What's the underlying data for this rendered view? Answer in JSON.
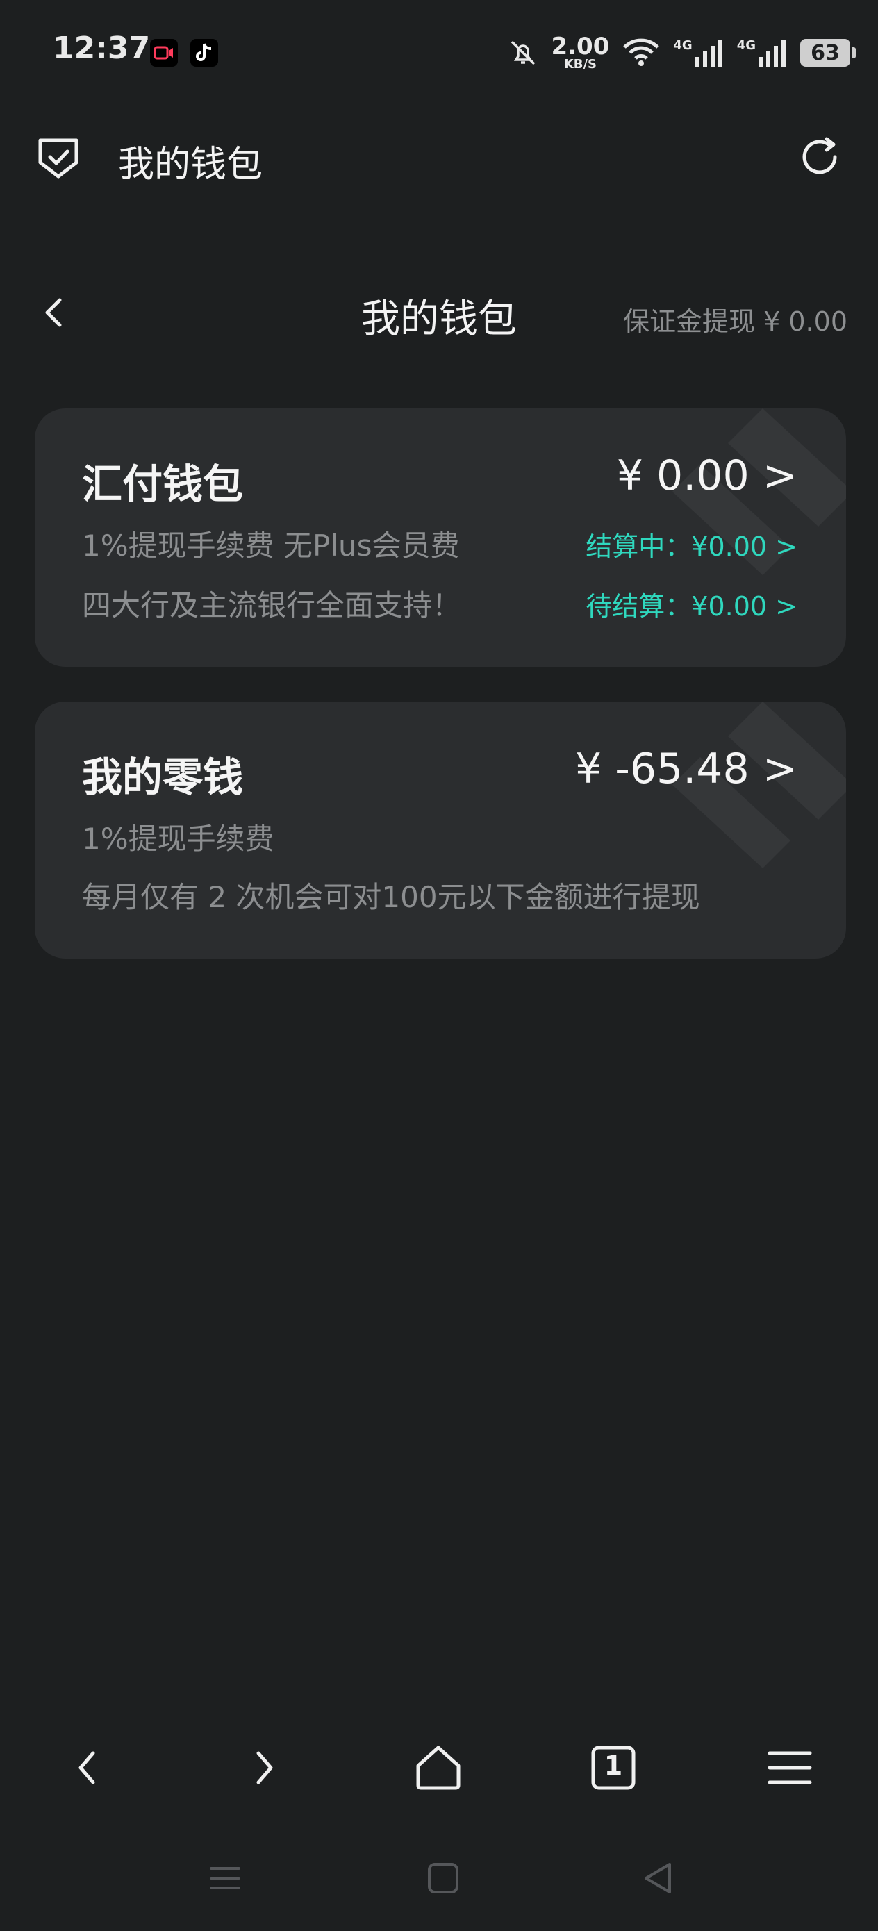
{
  "status_bar": {
    "time": "12:37",
    "net_speed_value": "2.00",
    "net_speed_unit": "KB/S",
    "signal1_label": "4G",
    "signal2_label": "4G",
    "battery": "63",
    "icons": [
      "screen-record-icon",
      "tiktok-icon",
      "mute-bell-icon",
      "wifi-icon",
      "signal-icon",
      "battery-icon"
    ]
  },
  "header": {
    "title": "我的钱包"
  },
  "page": {
    "title": "我的钱包",
    "deposit_label": "保证金提现 ¥ 0.00"
  },
  "cards": [
    {
      "title": "汇付钱包",
      "amount": "¥ 0.00 >",
      "lines": [
        "1%提现手续费 无Plus会员费",
        "四大行及主流银行全面支持！"
      ],
      "settling": "结算中：¥0.00 >",
      "pending": "待结算：¥0.00 >"
    },
    {
      "title": "我的零钱",
      "amount": "¥ -65.48 >",
      "lines": [
        "1%提现手续费",
        "每月仅有 2 次机会可对100元以下金额进行提现"
      ]
    }
  ],
  "browser_bar": {
    "tab_count": "1"
  },
  "colors": {
    "background": "#1d1f20",
    "card": "#2b2d2f",
    "accent_teal": "#2fd8be"
  }
}
